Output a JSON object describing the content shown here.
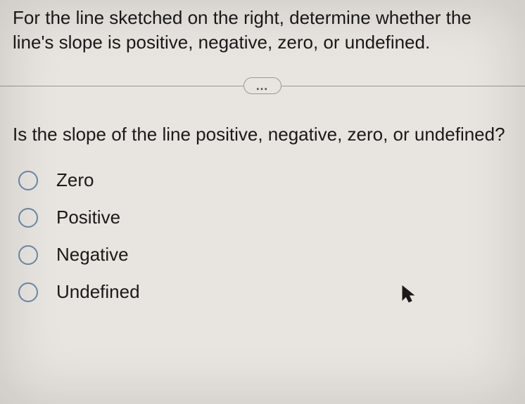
{
  "problem": {
    "statement": "For the line sketched on the right, determine whether the line's slope is positive, negative, zero, or undefined."
  },
  "divider": {
    "dots": "…"
  },
  "question": {
    "text": "Is the slope of the line positive, negative, zero, or undefined?"
  },
  "options": [
    {
      "label": "Zero"
    },
    {
      "label": "Positive"
    },
    {
      "label": "Negative"
    },
    {
      "label": "Undefined"
    }
  ]
}
